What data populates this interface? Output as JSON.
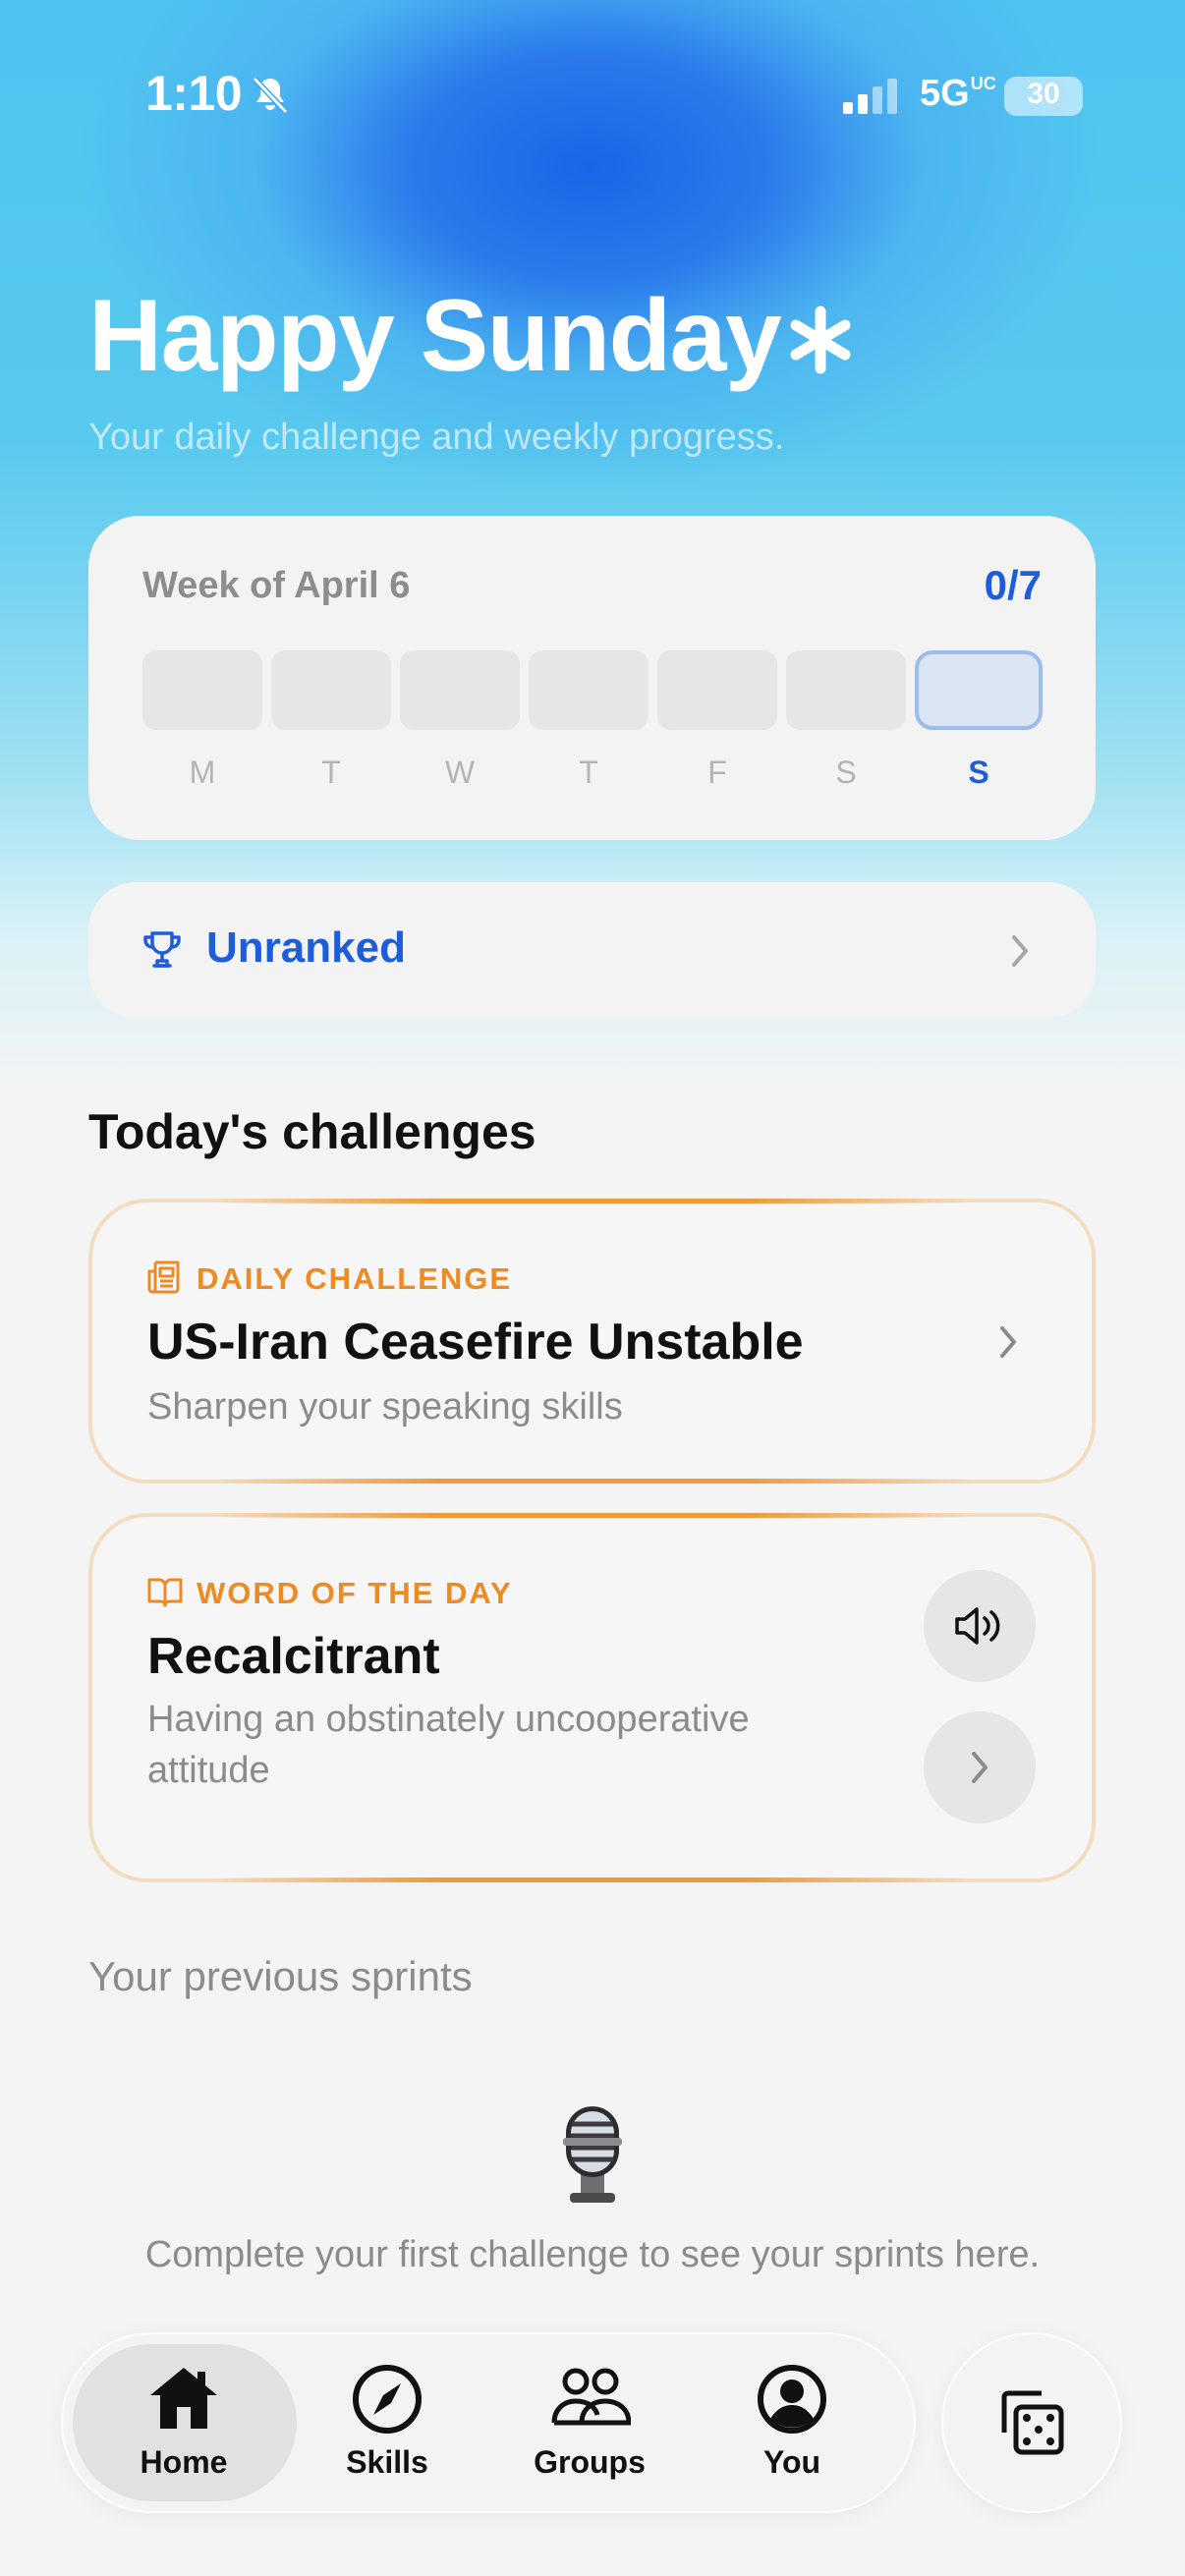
{
  "status_bar": {
    "time": "1:10",
    "network": "5G",
    "network_sup": "UC",
    "battery": "30",
    "icons": [
      "bell-slash-icon",
      "signal-icon",
      "battery-icon"
    ]
  },
  "header": {
    "title": "Happy Sunday",
    "subtitle": "Your daily challenge and weekly progress."
  },
  "week": {
    "title": "Week of April 6",
    "count": "0/7",
    "days": [
      "M",
      "T",
      "W",
      "T",
      "F",
      "S",
      "S"
    ],
    "completed": [
      false,
      false,
      false,
      false,
      false,
      false,
      false
    ],
    "today_index": 6
  },
  "rank": {
    "label": "Unranked",
    "icon": "trophy-icon"
  },
  "challenges": {
    "section_title": "Today's challenges",
    "daily": {
      "tag": "DAILY CHALLENGE",
      "title": "US-Iran Ceasefire Unstable",
      "subtitle": "Sharpen your speaking skills",
      "icon": "newspaper-icon"
    },
    "word": {
      "tag": "WORD OF THE DAY",
      "title": "Recalcitrant",
      "definition_line1": "Having an obstinately uncooperative",
      "definition_line2": "attitude",
      "icon": "book-icon"
    }
  },
  "sprints": {
    "title": "Your previous sprints",
    "empty_message": "Complete your first challenge to see your sprints here.",
    "icon": "microphone-icon"
  },
  "nav": {
    "items": [
      {
        "label": "Home",
        "icon": "home-icon",
        "active": true
      },
      {
        "label": "Skills",
        "icon": "compass-icon",
        "active": false
      },
      {
        "label": "Groups",
        "icon": "people-icon",
        "active": false
      },
      {
        "label": "You",
        "icon": "person-circle-icon",
        "active": false
      }
    ],
    "extra_button_icon": "dice-icon"
  },
  "colors": {
    "accent_blue": "#1d5ed8",
    "accent_orange": "#ee8a22",
    "background": "#f4f4f4"
  }
}
